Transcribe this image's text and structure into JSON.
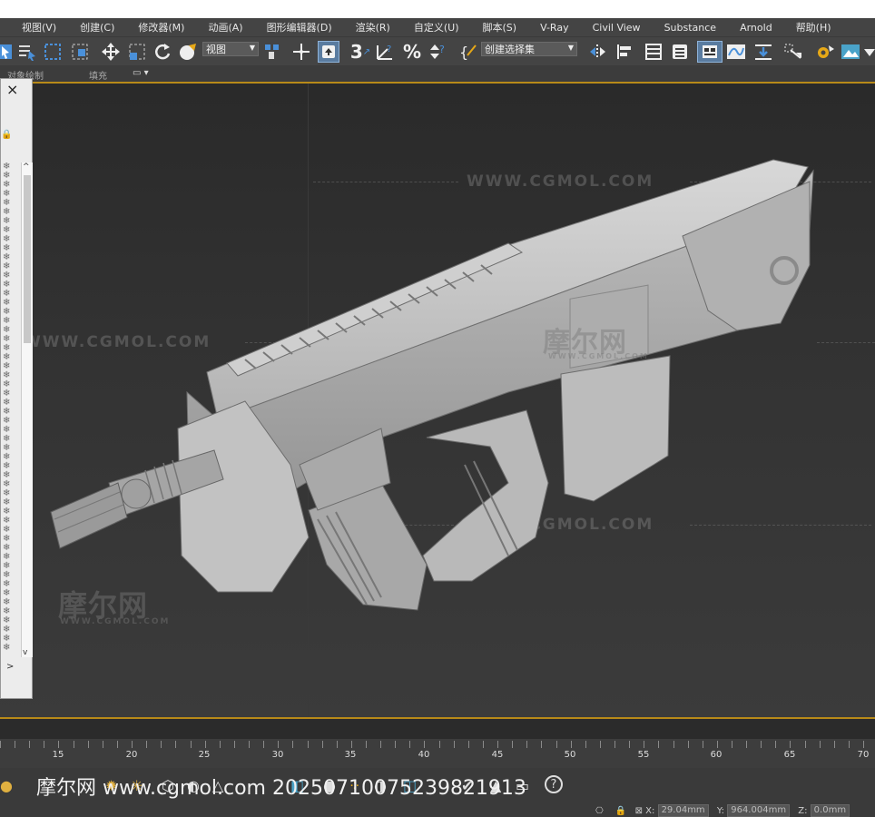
{
  "menu": [
    "视图(V)",
    "创建(C)",
    "修改器(M)",
    "动画(A)",
    "图形编辑器(D)",
    "渲染(R)",
    "自定义(U)",
    "脚本(S)",
    "V-Ray",
    "Civil View",
    "Substance",
    "Arnold",
    "帮助(H)"
  ],
  "toolbar": {
    "view_dropdown": "视图",
    "selection_set_dropdown": "创建选择集",
    "snap_label": "3"
  },
  "ribbon": {
    "object_paint": "对象绘制",
    "fill": "填充"
  },
  "viewport": {
    "watermarks": {
      "cgmol_top": "WWW.CGMOL.COM",
      "cgmol_left": "WWW.CGMOL.COM",
      "cgmol_bottom": "WWW.CGMOL.COM",
      "logo_center": "摩尔网",
      "logo_center_sub": "WWW.CGMOL.COM",
      "logo_lower_left": "摩尔网",
      "logo_lower_left_sub": "WWW.CGMOL.COM"
    }
  },
  "sidepanel": {
    "close": "×",
    "lock": "🔒",
    "row_glyph": "❄",
    "scroll_up": "^",
    "scroll_down": "v",
    "bottom": ">"
  },
  "timeline": {
    "labels": [
      "15",
      "20",
      "25",
      "30",
      "35",
      "40",
      "45",
      "50",
      "55",
      "60",
      "65",
      "70"
    ]
  },
  "bottombar": {
    "overlay_text": "摩尔网 www.cgmol.com 20250710075239821913",
    "help": "?",
    "x_label": "X:",
    "x_value": "29.04mm",
    "y_label": "Y:",
    "y_value": "964.004mm",
    "z_label": "Z:",
    "z_value": "0.0mm"
  },
  "colors": {
    "viewport_border": "#b88a18",
    "toolbar_bg": "#444444",
    "model_gray": "#b9b9b9"
  }
}
